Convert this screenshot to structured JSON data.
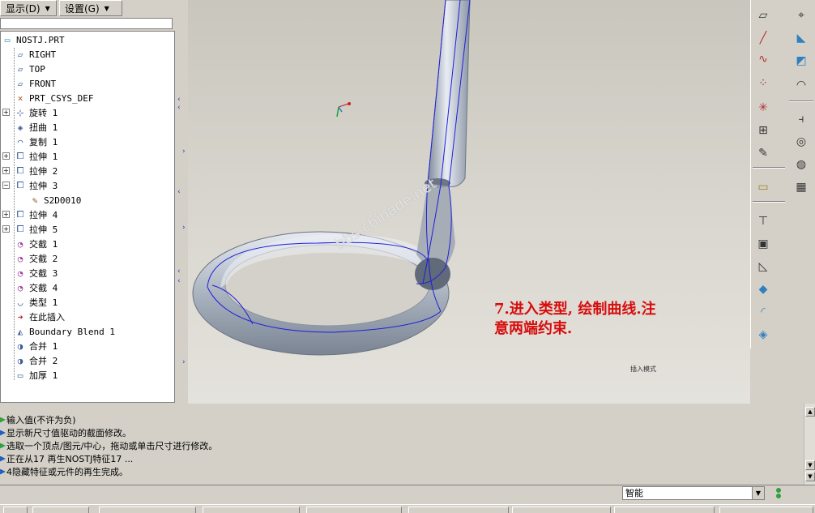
{
  "menu": {
    "display_label": "显示(D)",
    "settings_label": "设置(G)"
  },
  "tree": {
    "root": "NOSTJ.PRT",
    "items": [
      {
        "label": "RIGHT",
        "icon": "datum-plane-icon"
      },
      {
        "label": "TOP",
        "icon": "datum-plane-icon"
      },
      {
        "label": "FRONT",
        "icon": "datum-plane-icon"
      },
      {
        "label": "PRT_CSYS_DEF",
        "icon": "csys-icon"
      },
      {
        "label": "旋转 1",
        "icon": "revolve-icon"
      },
      {
        "label": "扭曲 1",
        "icon": "warp-icon"
      },
      {
        "label": "复制 1",
        "icon": "copy-icon"
      },
      {
        "label": "拉伸 1",
        "icon": "extrude-icon"
      },
      {
        "label": "拉伸 2",
        "icon": "extrude-icon"
      },
      {
        "label": "拉伸 3",
        "icon": "extrude-icon"
      },
      {
        "label": "S2D0010",
        "icon": "sketch-icon"
      },
      {
        "label": "拉伸 4",
        "icon": "extrude-icon"
      },
      {
        "label": "拉伸 5",
        "icon": "extrude-icon"
      },
      {
        "label": "交截 1",
        "icon": "intersect-icon"
      },
      {
        "label": "交截 2",
        "icon": "intersect-icon"
      },
      {
        "label": "交截 3",
        "icon": "intersect-icon"
      },
      {
        "label": "交截 4",
        "icon": "intersect-icon"
      },
      {
        "label": "类型 1",
        "icon": "style-icon"
      },
      {
        "label": "在此插入",
        "icon": "insert-arrow-icon"
      },
      {
        "label": "Boundary Blend 1",
        "icon": "boundary-blend-icon"
      },
      {
        "label": "合并 1",
        "icon": "merge-icon"
      },
      {
        "label": "合并 2",
        "icon": "merge-icon"
      },
      {
        "label": "加厚 1",
        "icon": "thicken-icon"
      }
    ]
  },
  "viewport": {
    "annotation_line1": "7.进入类型, 绘制曲线.注",
    "annotation_line2": "意两端约束.",
    "mode_label": "插入模式",
    "watermark": "bbs.chinade.net"
  },
  "messages": [
    "输入值(不许为负)",
    "显示新尺寸值驱动的截面修改。",
    "选取一个顶点/图元/中心，拖动或单击尺寸进行修改。",
    "正在从17 再生NOSTJ特征17 ...",
    "4隐藏特征或元件的再生完成。"
  ],
  "status": {
    "filter_value": "智能"
  },
  "colors": {
    "annotation": "#d80c0c",
    "tree_bg": "#ffffff",
    "panel_bg": "#d4d0c8",
    "curve_blue": "#1e1edc"
  }
}
